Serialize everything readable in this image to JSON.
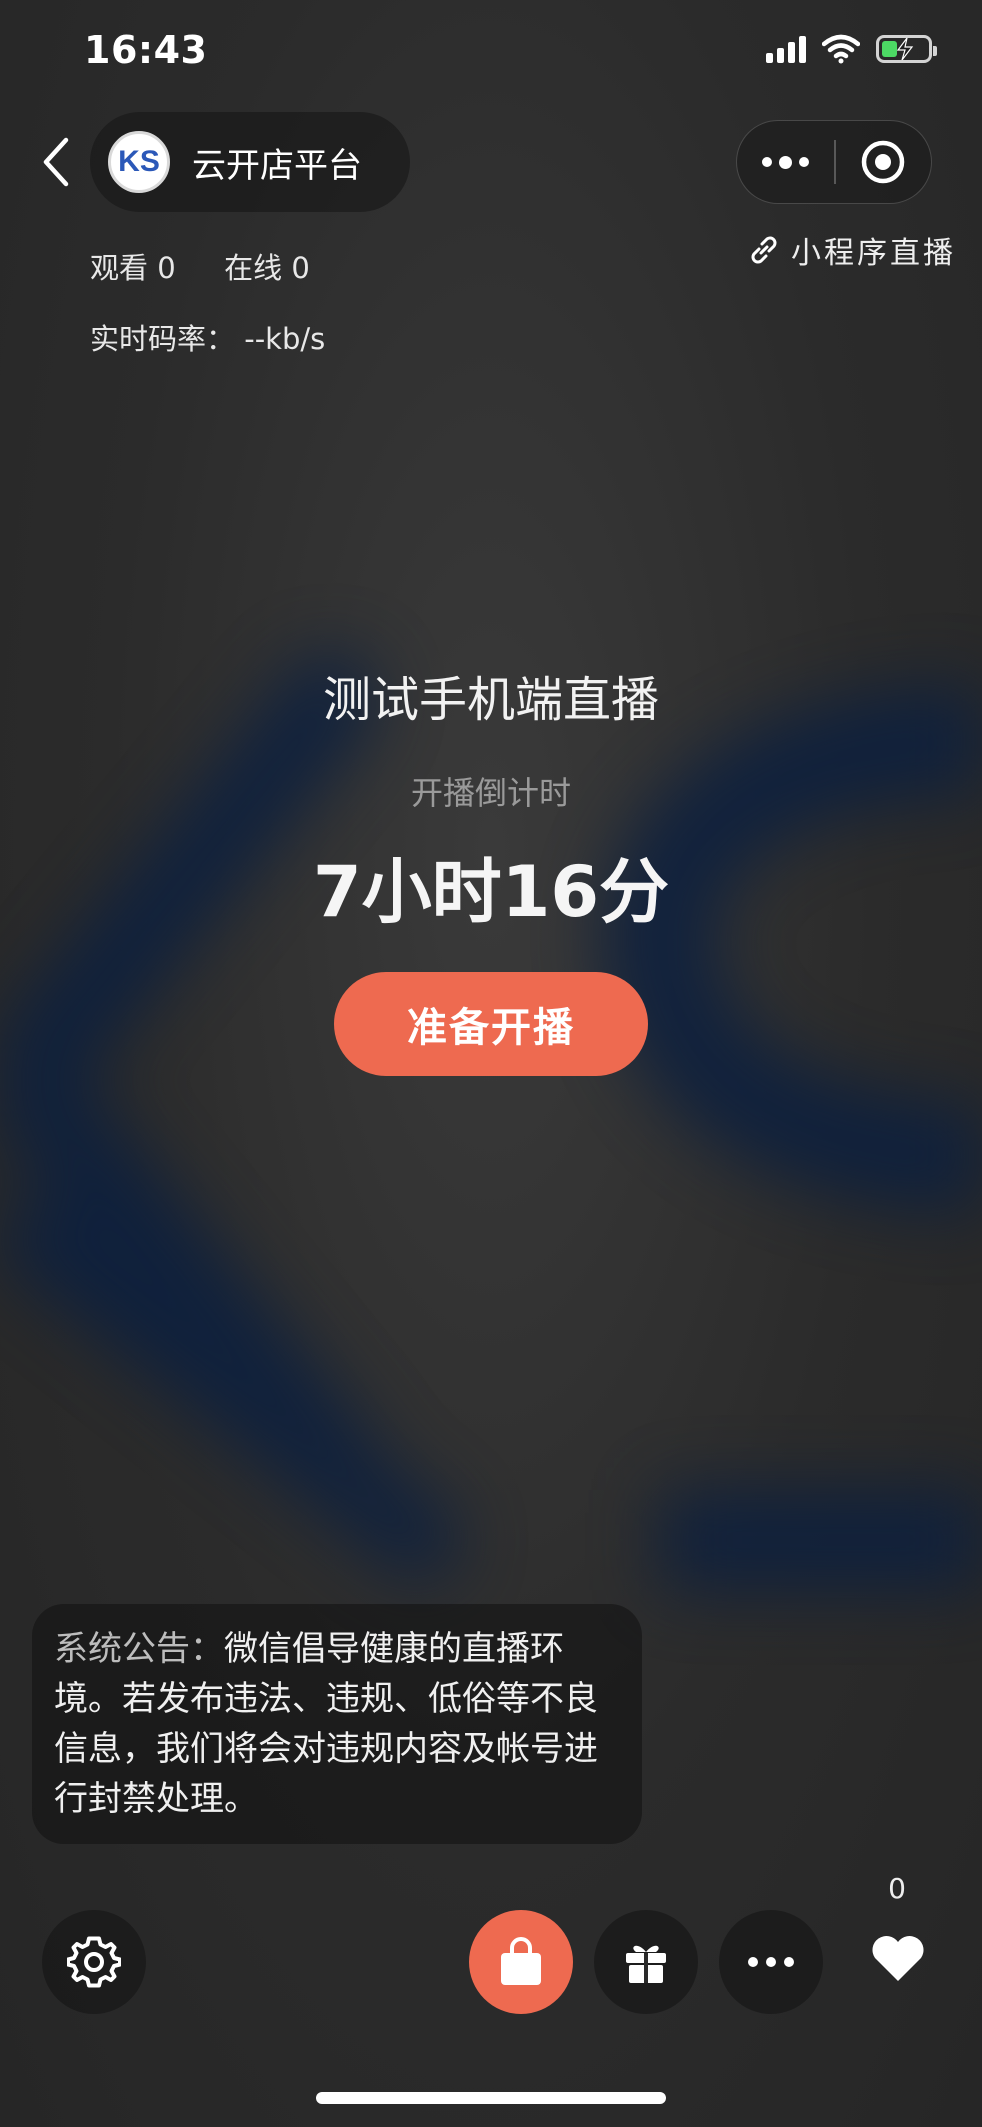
{
  "status_bar": {
    "time": "16:43",
    "icons": [
      "signal-icon",
      "wifi-icon",
      "battery-charging-icon"
    ],
    "battery_color": "#4cd964"
  },
  "header": {
    "avatar_text": "KS",
    "shop_name": "云开店平台",
    "mini_program_live": "小程序直播",
    "icons": [
      "back-icon",
      "more-icon",
      "close-icon",
      "link-icon"
    ]
  },
  "stats": {
    "views_label": "观看",
    "views": "0",
    "online_label": "在线",
    "online": "0",
    "bitrate_label": "实时码率：",
    "bitrate": "--kb/s"
  },
  "live": {
    "title": "测试手机端直播",
    "countdown_label": "开播倒计时",
    "countdown": "7小时16分",
    "start_button": "准备开播"
  },
  "notice": {
    "label": "系统公告：",
    "text": "微信倡导健康的直播环境。若发布违法、违规、低俗等不良信息，我们将会对违规内容及帐号进行封禁处理。"
  },
  "bottom_bar": {
    "like_count": "0",
    "icons": [
      "settings-icon",
      "shopping-bag-icon",
      "gift-icon",
      "more-icon",
      "heart-icon"
    ]
  },
  "colors": {
    "accent": "#ee6a50",
    "background": "#2c2c2c",
    "logo_blur": "#0b1f3f"
  }
}
